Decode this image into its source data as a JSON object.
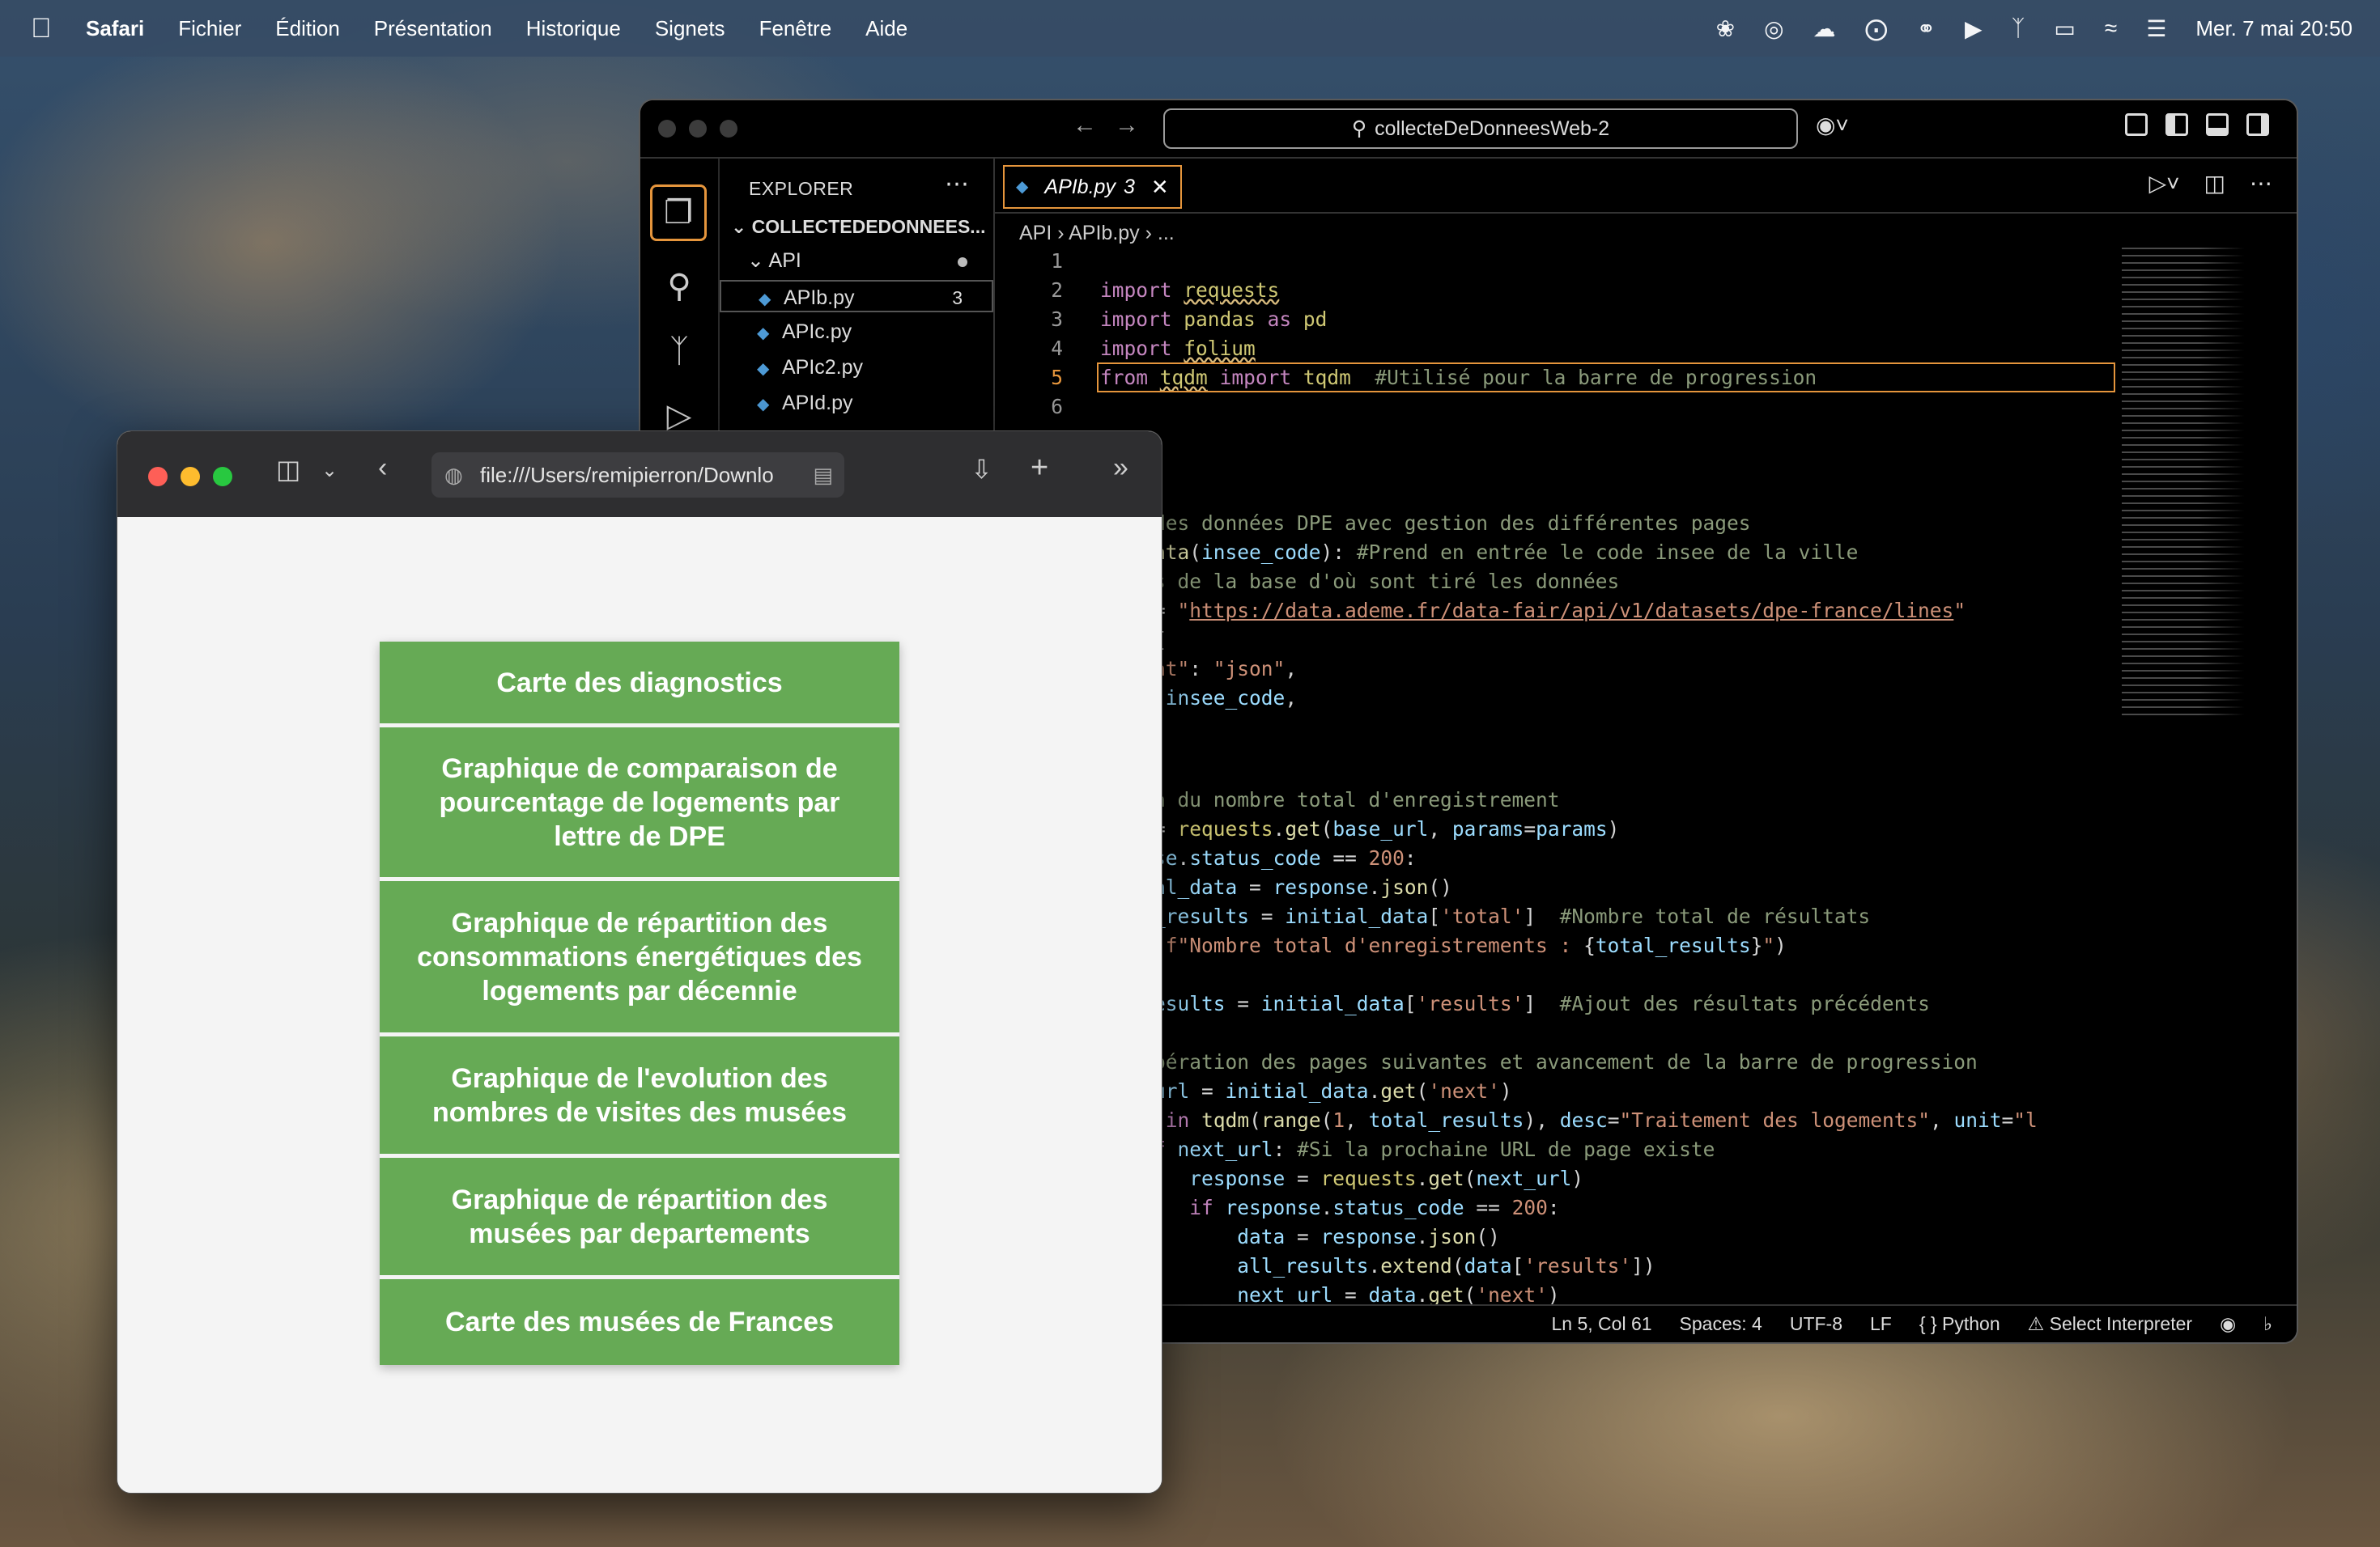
{
  "menubar": {
    "app": "Safari",
    "items": [
      "Fichier",
      "Édition",
      "Présentation",
      "Historique",
      "Signets",
      "Fenêtre",
      "Aide"
    ],
    "clock": "Mer. 7 mai  20:50"
  },
  "vscode": {
    "search": "collecteDeDonneesWeb-2",
    "explorer": {
      "title": "EXPLORER",
      "root": "COLLECTEDEDONNEES...",
      "folder": "API",
      "files": [
        {
          "name": "APIb.py",
          "badge": "3"
        },
        {
          "name": "APIc.py",
          "badge": ""
        },
        {
          "name": "APIc2.py",
          "badge": ""
        },
        {
          "name": "APId.py",
          "badge": ""
        }
      ]
    },
    "tab": {
      "name": "APIb.py",
      "badge": "3"
    },
    "breadcrumb": "API  ›  APIb.py  ›  ...",
    "line_numbers": [
      "1",
      "2",
      "3",
      "4",
      "5",
      "6"
    ],
    "status": {
      "position": "Ln 5, Col 61",
      "spaces": "Spaces: 4",
      "encoding": "UTF-8",
      "eol": "LF",
      "language": "Python",
      "interpreter": "Select Interpreter"
    }
  },
  "safari": {
    "url": "file:///Users/remipierron/Downlo",
    "buttons": [
      "Carte des diagnostics",
      "Graphique de comparaison de pourcentage de logements par lettre de DPE",
      "Graphique de répartition des consommations énergétiques des logements par décennie",
      "Graphique de l'evolution des nombres de visites des musées",
      "Graphique de répartition des musées par departements",
      "Carte des musées de Frances"
    ]
  },
  "colors": {
    "accent": "#e5953c",
    "button_green": "#66aa55"
  }
}
